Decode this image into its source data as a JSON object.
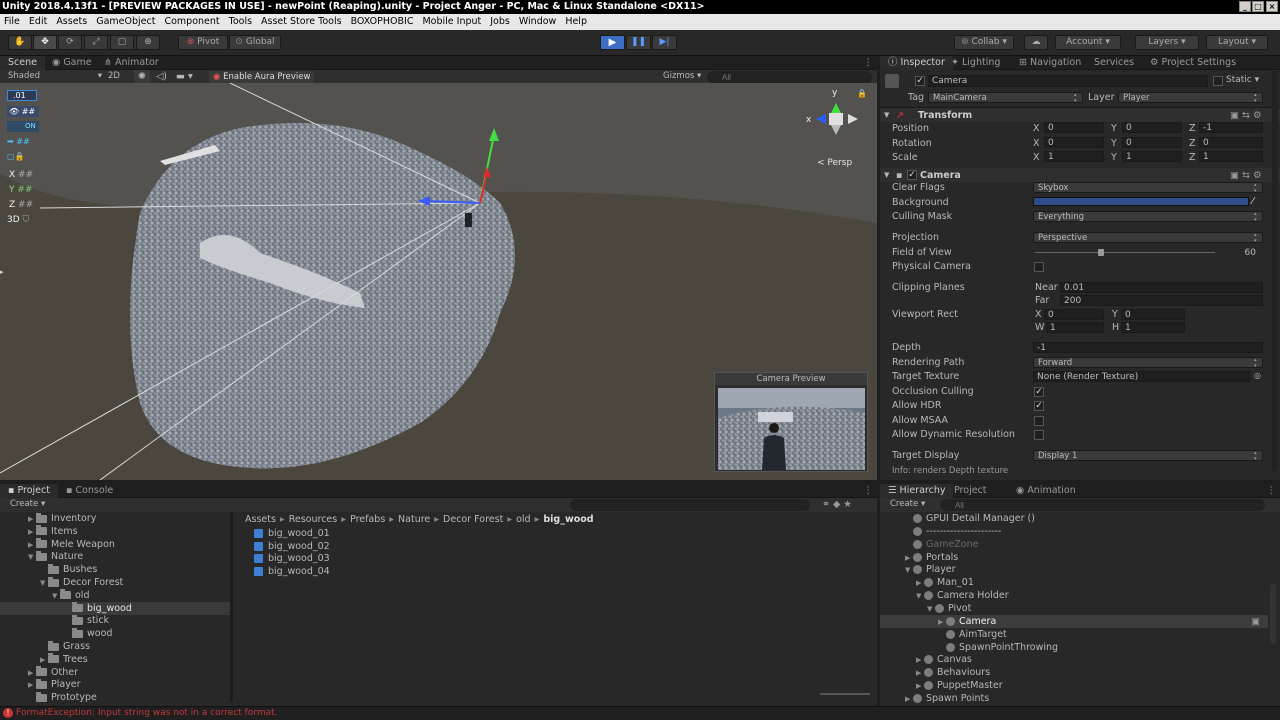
{
  "window": {
    "title": "Unity 2018.4.13f1 - [PREVIEW PACKAGES IN USE] - newPoint (Reaping).unity - Project Anger - PC, Mac & Linux Standalone <DX11>"
  },
  "menu": [
    "File",
    "Edit",
    "Assets",
    "GameObject",
    "Component",
    "Tools",
    "Asset Store Tools",
    "BOXOPHOBIC",
    "Mobile Input",
    "Jobs",
    "Window",
    "Help"
  ],
  "toolbar": {
    "pivot": "Pivot",
    "global": "Global",
    "collab": "Collab",
    "account": "Account",
    "layers": "Layers",
    "layout": "Layout"
  },
  "scene_tabs": [
    "Scene",
    "Game",
    "Animator"
  ],
  "scene_bar": {
    "shading": "Shaded",
    "mode2d": "2D",
    "aura": "Enable Aura Preview",
    "gizmos": "Gizmos",
    "search_placeholder": "All"
  },
  "scene_overlay": {
    "persp": "Persp",
    "camera_preview": "Camera Preview",
    "tool_value": ".01",
    "tool_on": "ON",
    "axis_x": "X",
    "axis_y": "Y",
    "axis_z": "Z",
    "mode_3d": "3D",
    "gizmo_y": "y",
    "gizmo_x": "x"
  },
  "inspector_tabs": [
    "Inspector",
    "Lighting",
    "Navigation",
    "Services",
    "Project Settings"
  ],
  "inspector": {
    "object_name": "Camera",
    "static_label": "Static",
    "tag_label": "Tag",
    "tag_value": "MainCamera",
    "layer_label": "Layer",
    "layer_value": "Player",
    "transform": {
      "title": "Transform",
      "rows": [
        {
          "label": "Position",
          "x": "0",
          "y": "0",
          "z": "-1"
        },
        {
          "label": "Rotation",
          "x": "0",
          "y": "0",
          "z": "0"
        },
        {
          "label": "Scale",
          "x": "1",
          "y": "1",
          "z": "1"
        }
      ]
    },
    "camera": {
      "title": "Camera",
      "clear_flags": "Clear Flags",
      "clear_flags_v": "Skybox",
      "background": "Background",
      "background_color": "#2f4d8c",
      "culling": "Culling Mask",
      "culling_v": "Everything",
      "projection": "Projection",
      "projection_v": "Perspective",
      "fov": "Field of View",
      "fov_v": "60",
      "fov_fraction": 0.35,
      "physical": "Physical Camera",
      "clipping": "Clipping Planes",
      "near": "Near",
      "near_v": "0.01",
      "far": "Far",
      "far_v": "200",
      "viewport": "Viewport Rect",
      "vx": "0",
      "vy": "0",
      "vw": "1",
      "vh": "1",
      "depth": "Depth",
      "depth_v": "-1",
      "render_path": "Rendering Path",
      "render_path_v": "Forward",
      "target_tex": "Target Texture",
      "target_tex_v": "None (Render Texture)",
      "occlusion": "Occlusion Culling",
      "hdr": "Allow HDR",
      "msaa": "Allow MSAA",
      "dyn_res": "Allow Dynamic Resolution",
      "target_display": "Target Display",
      "target_display_v": "Display 1",
      "info": "Info: renders Depth texture"
    }
  },
  "project_tabs": [
    "Project",
    "Console"
  ],
  "project": {
    "create": "Create",
    "tree": [
      {
        "label": "Inventory",
        "depth": 1,
        "arrow": "▶"
      },
      {
        "label": "Items",
        "depth": 1,
        "arrow": "▶"
      },
      {
        "label": "Mele Weapon",
        "depth": 1,
        "arrow": "▶"
      },
      {
        "label": "Nature",
        "depth": 1,
        "arrow": "▼"
      },
      {
        "label": "Bushes",
        "depth": 2,
        "arrow": ""
      },
      {
        "label": "Decor Forest",
        "depth": 2,
        "arrow": "▼"
      },
      {
        "label": "old",
        "depth": 3,
        "arrow": "▼"
      },
      {
        "label": "big_wood",
        "depth": 4,
        "arrow": "",
        "selected": true
      },
      {
        "label": "stick",
        "depth": 4,
        "arrow": ""
      },
      {
        "label": "wood",
        "depth": 4,
        "arrow": ""
      },
      {
        "label": "Grass",
        "depth": 2,
        "arrow": ""
      },
      {
        "label": "Trees",
        "depth": 2,
        "arrow": "▶"
      },
      {
        "label": "Other",
        "depth": 1,
        "arrow": "▶"
      },
      {
        "label": "Player",
        "depth": 1,
        "arrow": "▶"
      },
      {
        "label": "Prototype",
        "depth": 1,
        "arrow": ""
      }
    ],
    "breadcrumb": [
      "Assets",
      "Resources",
      "Prefabs",
      "Nature",
      "Decor Forest",
      "old",
      "big_wood"
    ],
    "assets": [
      "big_wood_01",
      "big_wood_02",
      "big_wood_03",
      "big_wood_04"
    ]
  },
  "hierarchy_tabs": [
    "Hierarchy",
    "Project",
    "Animation"
  ],
  "hierarchy": {
    "create": "Create",
    "search_placeholder": "All",
    "items": [
      {
        "label": "GPUI Detail Manager ()",
        "depth": 1,
        "arrow": "",
        "dim": false
      },
      {
        "label": "----------------------",
        "depth": 1,
        "arrow": "",
        "dim": false
      },
      {
        "label": "GameZone",
        "depth": 1,
        "arrow": "",
        "dim": true
      },
      {
        "label": "Portals",
        "depth": 1,
        "arrow": "▶",
        "dim": false
      },
      {
        "label": "Player",
        "depth": 1,
        "arrow": "▼",
        "dim": false
      },
      {
        "label": "Man_01",
        "depth": 2,
        "arrow": "▶",
        "dim": false
      },
      {
        "label": "Camera Holder",
        "depth": 2,
        "arrow": "▼",
        "dim": false
      },
      {
        "label": "Pivot",
        "depth": 3,
        "arrow": "▼",
        "dim": false
      },
      {
        "label": "Camera",
        "depth": 4,
        "arrow": "▶",
        "dim": false,
        "selected": true
      },
      {
        "label": "AimTarget",
        "depth": 4,
        "arrow": "",
        "dim": false
      },
      {
        "label": "SpawnPointThrowing",
        "depth": 4,
        "arrow": "",
        "dim": false
      },
      {
        "label": "Canvas",
        "depth": 2,
        "arrow": "▶",
        "dim": false
      },
      {
        "label": "Behaviours",
        "depth": 2,
        "arrow": "▶",
        "dim": false
      },
      {
        "label": "PuppetMaster",
        "depth": 2,
        "arrow": "▶",
        "dim": false
      },
      {
        "label": "Spawn Points",
        "depth": 1,
        "arrow": "▶",
        "dim": false
      }
    ]
  },
  "status": {
    "error": "FormatException: Input string was not in a correct format."
  }
}
